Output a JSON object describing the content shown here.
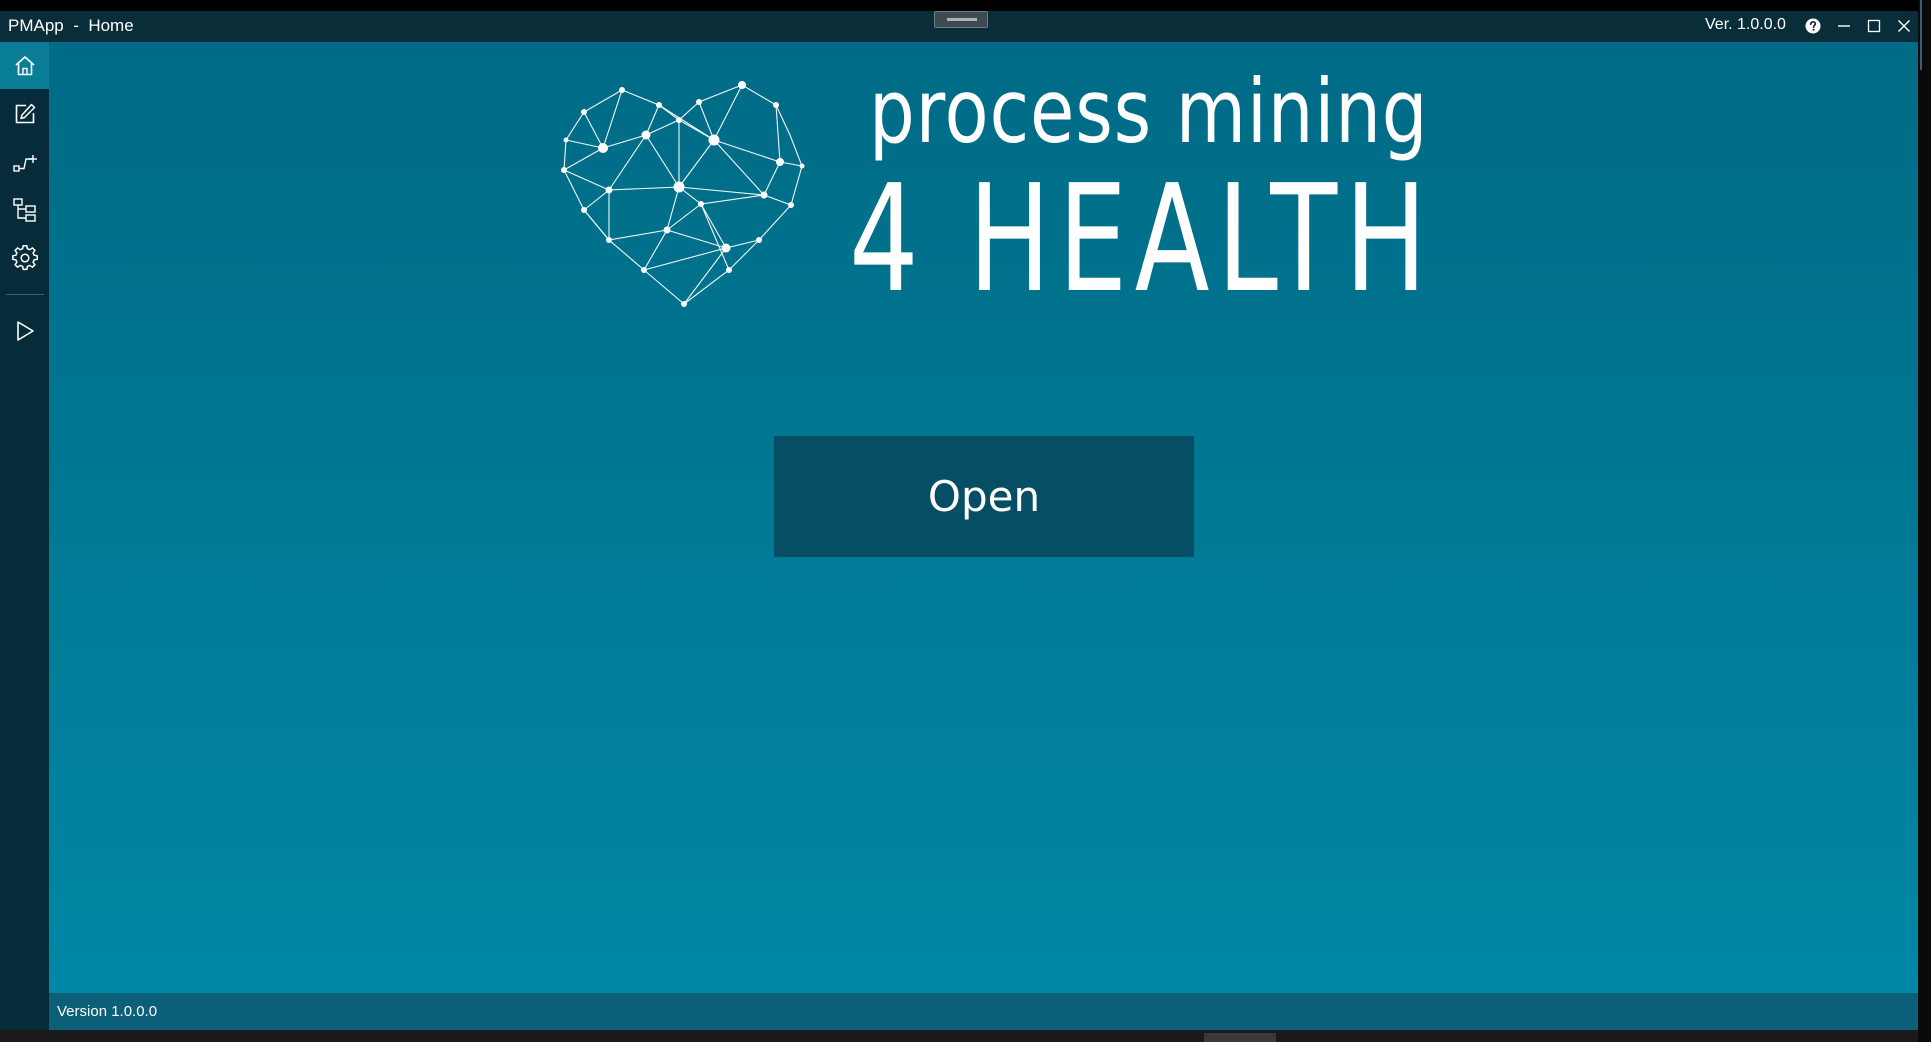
{
  "window": {
    "app_name": "PMApp",
    "separator": "-",
    "page": "Home",
    "version": "Ver. 1.0.0.0"
  },
  "window_controls": {
    "help_icon": "help-circle-icon",
    "minimize_icon": "minimize-icon",
    "maximize_icon": "maximize-icon",
    "close_icon": "close-icon"
  },
  "sidebar": {
    "items": [
      {
        "name": "home",
        "icon": "home-icon",
        "active": true
      },
      {
        "name": "edit",
        "icon": "edit-icon",
        "active": false
      },
      {
        "name": "process-flow",
        "icon": "flow-icon",
        "active": false
      },
      {
        "name": "hierarchy",
        "icon": "hierarchy-icon",
        "active": false
      },
      {
        "name": "settings",
        "icon": "gear-icon",
        "active": false
      },
      {
        "name": "run",
        "icon": "play-icon",
        "active": false
      }
    ]
  },
  "logo": {
    "line1": "process mining",
    "line2": "4 HEALTH",
    "icon": "network-heart-icon"
  },
  "main": {
    "open_button_label": "Open"
  },
  "status_bar": {
    "version_text": "Version 1.0.0.0"
  },
  "colors": {
    "titlebar": "#0a2d3a",
    "sidebar": "#062c3a",
    "sidebar_active": "#0a7d97",
    "main_top": "#006b86",
    "main_bottom": "#0088a6",
    "button": "#064e64",
    "statusbar": "#0b5f78"
  }
}
